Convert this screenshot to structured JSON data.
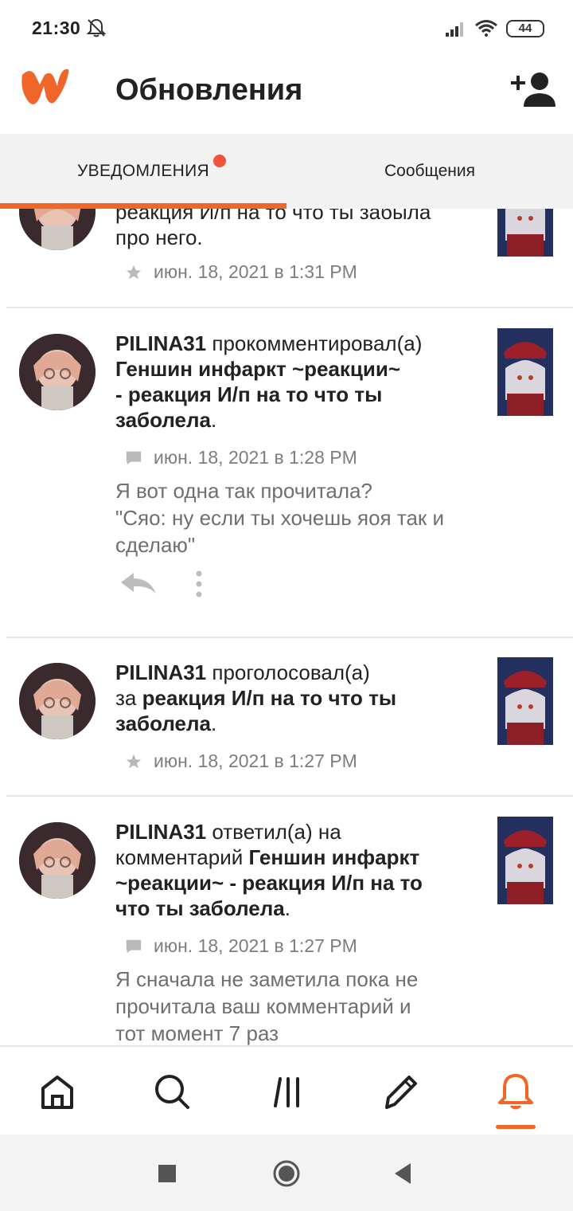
{
  "status_bar": {
    "time": "21:30",
    "battery": "44",
    "icons": [
      "bell-off-icon",
      "signal-icon",
      "wifi-icon",
      "battery-icon"
    ]
  },
  "header": {
    "title": "Обновления",
    "logo_icon": "wattpad-logo",
    "action_icon": "add-user-icon"
  },
  "tabs": [
    {
      "label": "УВЕДОМЛЕНИЯ",
      "active": true,
      "has_dot": true
    },
    {
      "label": "Сообщения",
      "active": false
    }
  ],
  "colors": {
    "accent": "#f06628",
    "dot": "#f0553a",
    "meta_text": "#7d7d7d"
  },
  "notifications": [
    {
      "text_line1": "реакция И/п на то что ты забыла",
      "text_line2": "про него",
      "period": ".",
      "meta_icon": "star-icon",
      "time": "июн. 18, 2021 в 1:31 PM"
    },
    {
      "user": "PILINA31",
      "action": " прокомментировал(а)",
      "story_line1": "Геншин инфаркт ~реакции~",
      "story_line2": "- реакция И/п на то что ты",
      "story_line3": "заболела",
      "period": ".",
      "meta_icon": "comment-icon",
      "time": "июн. 18, 2021 в 1:28 PM",
      "comment_line1": "Я вот одна так прочитала?",
      "comment_line2": "\"Сяо: ну если ты хочешь яоя так и",
      "comment_line3": "сделаю\"",
      "actions": [
        "reply-icon",
        "more-icon"
      ]
    },
    {
      "user": "PILINA31",
      "action": " проголосовал(а)",
      "prefix": "за ",
      "story_line1": "реакция И/п на то что ты",
      "story_line2": "заболела",
      "period": ".",
      "meta_icon": "star-icon",
      "time": "июн. 18, 2021 в 1:27 PM"
    },
    {
      "user": "PILINA31",
      "action": " ответил(а) на",
      "prefix": "комментарий ",
      "story_line1": "Геншин инфаркт",
      "story_line2": "~реакции~ - реакция И/п на то",
      "story_line3": "что ты заболела",
      "period": ".",
      "meta_icon": "comment-icon",
      "time": "июн. 18, 2021 в 1:27 PM",
      "comment_line1": "Я сначала не заметила пока не",
      "comment_line2": "прочитала ваш комментарий и",
      "comment_line3": "тот момент 7 раз"
    }
  ],
  "bottom_nav": [
    {
      "icon": "home-icon",
      "active": false
    },
    {
      "icon": "search-icon",
      "active": false
    },
    {
      "icon": "library-icon",
      "active": false
    },
    {
      "icon": "write-icon",
      "active": false
    },
    {
      "icon": "notifications-bell-icon",
      "active": true
    }
  ],
  "system_nav": [
    "recents-icon",
    "home-circle-icon",
    "back-icon"
  ]
}
